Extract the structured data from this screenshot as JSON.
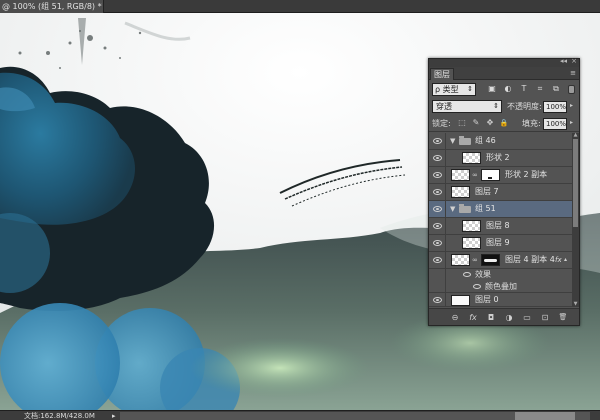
{
  "document_tab": {
    "title": "@ 100% (组 51, RGB/8) *",
    "close_label": "×"
  },
  "status_bar": {
    "doc_info": "文档:162.8M/428.0M",
    "arrow": "▸"
  },
  "layers_panel": {
    "collapse_label": "◂◂",
    "close_label": "×",
    "tab_label": "图层",
    "menu_label": "≡",
    "filter": {
      "kind_label": "ρ 类型",
      "icons": [
        "image-filter-icon",
        "adjustment-filter-icon",
        "type-filter-icon",
        "shape-filter-icon",
        "smart-object-filter-icon"
      ],
      "icon_glyphs": [
        "▣",
        "◐",
        "T",
        "⌗",
        "⧉"
      ]
    },
    "blend": {
      "mode": "穿透",
      "opacity_label": "不透明度:",
      "opacity_value": "100%"
    },
    "lock": {
      "label": "锁定:",
      "glyphs": [
        "⬚",
        "✎",
        "✥",
        "🔒"
      ],
      "fill_label": "填充:",
      "fill_value": "100%"
    },
    "layers": [
      {
        "name": "组 46",
        "type": "group",
        "expanded": true,
        "indent": 0
      },
      {
        "name": "形状 2",
        "type": "layer",
        "thumb": "transparent",
        "indent": 1
      },
      {
        "name": "形状 2 副本",
        "type": "layer",
        "thumb": "transparent",
        "mask": true,
        "indent": 1
      },
      {
        "name": "图层 7",
        "type": "layer",
        "thumb": "transparent",
        "indent": 0
      },
      {
        "name": "组 51",
        "type": "group",
        "expanded": true,
        "indent": 0,
        "selected": true
      },
      {
        "name": "图层 8",
        "type": "layer",
        "thumb": "transparent",
        "indent": 1
      },
      {
        "name": "图层 9",
        "type": "layer",
        "thumb": "transparent",
        "indent": 1
      },
      {
        "name": "图层 4 副本 4",
        "type": "layer",
        "thumb": "transparent",
        "mask": "dark",
        "fx": "fx",
        "indent": 0
      },
      {
        "name": "效果",
        "type": "effects-header"
      },
      {
        "name": "颜色叠加",
        "type": "effect"
      },
      {
        "name": "图层 0",
        "type": "layer",
        "thumb": "white",
        "indent": 0
      }
    ],
    "footer_icons": [
      "link-layers-icon",
      "fx-icon",
      "add-mask-icon",
      "adjustment-layer-icon",
      "new-group-icon",
      "new-layer-icon",
      "trash-icon"
    ],
    "footer_glyphs": [
      "⊖",
      "fx",
      "◘",
      "◑",
      "▭",
      "⊡",
      "🗑"
    ]
  },
  "colors": {
    "selected_row": "#5a6a80",
    "panel_bg": "#535353"
  }
}
